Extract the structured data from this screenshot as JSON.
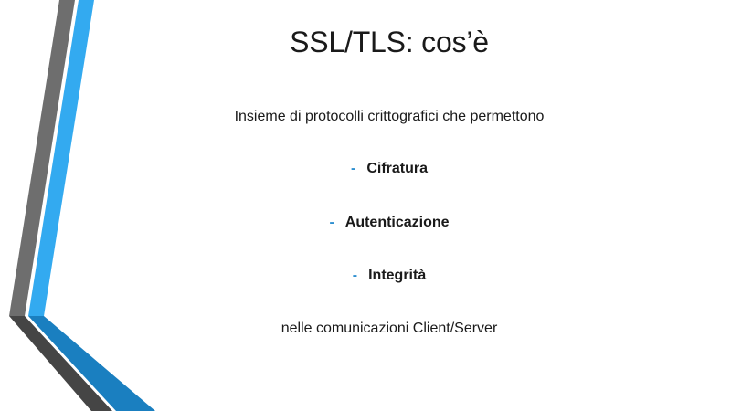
{
  "slide": {
    "title": "SSL/TLS: cos’è",
    "intro": "Insieme di protocolli crittografici che permettono",
    "bullet_marker": "-",
    "bullets": [
      "Cifratura",
      "Autenticazione",
      "Integrità"
    ],
    "outro": "nelle comunicazioni Client/Server"
  },
  "colors": {
    "accent_blue": "#33aaf0",
    "dark_blue": "#1a7fc0",
    "gray": "#6e6e6e",
    "dark_gray": "#454545"
  }
}
